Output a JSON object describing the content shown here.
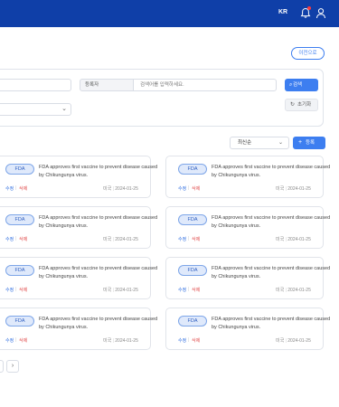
{
  "header": {
    "lang": "KR",
    "notification_icon": "bell-icon",
    "user_icon": "user-icon",
    "accent": "#0f3fa8"
  },
  "toolbar": {
    "back_label": "이전으로"
  },
  "search": {
    "reg_label": "등록자",
    "reg_placeholder": "검색어를 입력하세요.",
    "search_label": "검색",
    "reset_label": "초기화"
  },
  "list": {
    "sort_value": "최신순",
    "add_label": "등록",
    "cards": [
      {
        "badge": "FDA",
        "text": "FDA approves first vaccine to prevent disease caused by Chikungunya virus.",
        "edit": "수정",
        "delete": "삭제",
        "author": "미국",
        "date": "2024-01-25"
      },
      {
        "badge": "FDA",
        "text": "FDA approves first vaccine to prevent disease caused by Chikungunya virus.",
        "edit": "수정",
        "delete": "삭제",
        "author": "미국",
        "date": "2024-01-25"
      },
      {
        "badge": "FDA",
        "text": "FDA approves first vaccine to prevent disease caused by Chikungunya virus.",
        "edit": "수정",
        "delete": "삭제",
        "author": "미국",
        "date": "2024-01-25"
      },
      {
        "badge": "FDA",
        "text": "FDA approves first vaccine to prevent disease caused by Chikungunya virus.",
        "edit": "수정",
        "delete": "삭제",
        "author": "미국",
        "date": "2024-01-25"
      },
      {
        "badge": "FDA",
        "text": "FDA approves first vaccine to prevent disease caused by Chikungunya virus.",
        "edit": "수정",
        "delete": "삭제",
        "author": "미국",
        "date": "2024-01-25"
      },
      {
        "badge": "FDA",
        "text": "FDA approves first vaccine to prevent disease caused by Chikungunya virus.",
        "edit": "수정",
        "delete": "삭제",
        "author": "미국",
        "date": "2024-01-25"
      },
      {
        "badge": "FDA",
        "text": "FDA approves first vaccine to prevent disease caused by Chikungunya virus.",
        "edit": "수정",
        "delete": "삭제",
        "author": "미국",
        "date": "2024-01-25"
      },
      {
        "badge": "FDA",
        "text": "FDA approves first vaccine to prevent disease caused by Chikungunya virus.",
        "edit": "수정",
        "delete": "삭제",
        "author": "미국",
        "date": "2024-01-25"
      }
    ]
  },
  "pagination": {
    "next": "›"
  }
}
